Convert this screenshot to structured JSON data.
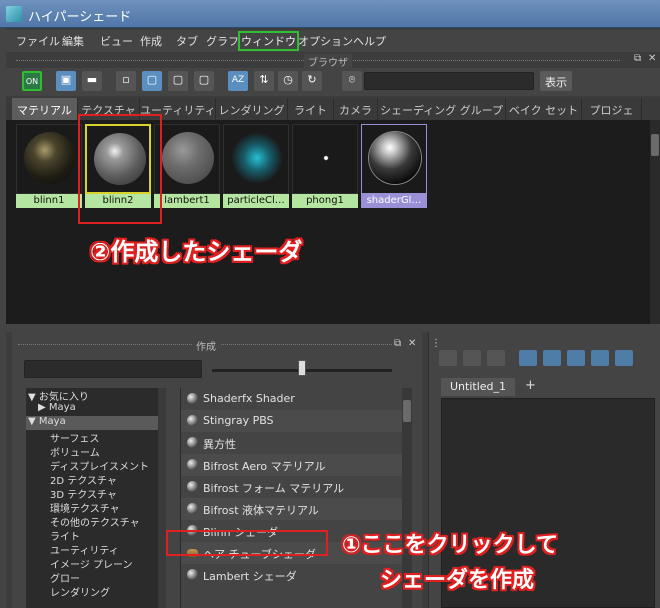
{
  "window": {
    "title": "ハイパーシェード"
  },
  "menu": {
    "items": [
      "ファイル",
      "編集",
      "ビュー",
      "作成",
      "タブ",
      "グラフ",
      "ウィンドウ",
      "オプション",
      "ヘルプ"
    ],
    "highlighted": "ウィンドウ"
  },
  "browser": {
    "label": "ブラウザ",
    "search_value": "",
    "display_button": "表示"
  },
  "toolbar": {
    "on_label": "ON",
    "sort_label": "AZ"
  },
  "tabs": [
    "マテリアル",
    "テクスチャ",
    "ユーティリティ",
    "レンダリング",
    "ライト",
    "カメラ",
    "シェーディング グループ",
    "ベイク セット",
    "プロジェ"
  ],
  "active_tab": "マテリアル",
  "swatches": [
    {
      "label": "blinn1",
      "look": "dark-gold"
    },
    {
      "label": "blinn2",
      "look": "gray-shiny",
      "selected": true
    },
    {
      "label": "lambert1",
      "look": "gray-matte"
    },
    {
      "label": "particleCl…",
      "look": "cyan-glow"
    },
    {
      "label": "phong1",
      "look": "checker-dot"
    },
    {
      "label": "shaderGl…",
      "look": "glossy-black",
      "highlight": "#9a90d8"
    }
  ],
  "create": {
    "label": "作成",
    "filter_value": "",
    "tree": [
      {
        "label": "お気に入り",
        "arrow": "▼",
        "level": 0
      },
      {
        "label": "Maya",
        "arrow": "▶",
        "level": 0,
        "indent": 1
      },
      {
        "label": "Maya",
        "arrow": "▼",
        "level": 0,
        "selected": true
      },
      {
        "label": "サーフェス",
        "level": 1
      },
      {
        "label": "ボリューム",
        "level": 1
      },
      {
        "label": "ディスプレイスメント",
        "level": 1
      },
      {
        "label": "2D テクスチャ",
        "level": 1
      },
      {
        "label": "3D テクスチャ",
        "level": 1
      },
      {
        "label": "環境テクスチャ",
        "level": 1
      },
      {
        "label": "その他のテクスチャ",
        "level": 1
      },
      {
        "label": "ライト",
        "level": 1
      },
      {
        "label": "ユーティリティ",
        "level": 1
      },
      {
        "label": "イメージ プレーン",
        "level": 1
      },
      {
        "label": "グロー",
        "level": 1
      },
      {
        "label": "レンダリング",
        "level": 1
      }
    ],
    "nodes": [
      {
        "label": "Shaderfx Shader",
        "icon": "sphere"
      },
      {
        "label": "Stingray PBS",
        "icon": "sphere"
      },
      {
        "label": "異方性",
        "icon": "sphere"
      },
      {
        "label": "Bifrost Aero マテリアル",
        "icon": "sphere"
      },
      {
        "label": "Bifrost フォーム マテリアル",
        "icon": "sphere"
      },
      {
        "label": "Bifrost 液体マテリアル",
        "icon": "sphere"
      },
      {
        "label": "Blinn シェーダ",
        "icon": "sphere"
      },
      {
        "label": "ヘア チューブシェーダ",
        "icon": "hair"
      },
      {
        "label": "Lambert シェーダ",
        "icon": "sphere"
      }
    ]
  },
  "editor": {
    "tab_label": "Untitled_1",
    "add_tab": "+"
  },
  "annotations": {
    "created_shader": "②作成したシェーダ",
    "click_here_line1": "①ここをクリックして",
    "click_here_line2": "シェーダを作成",
    "color": "#e02020"
  }
}
